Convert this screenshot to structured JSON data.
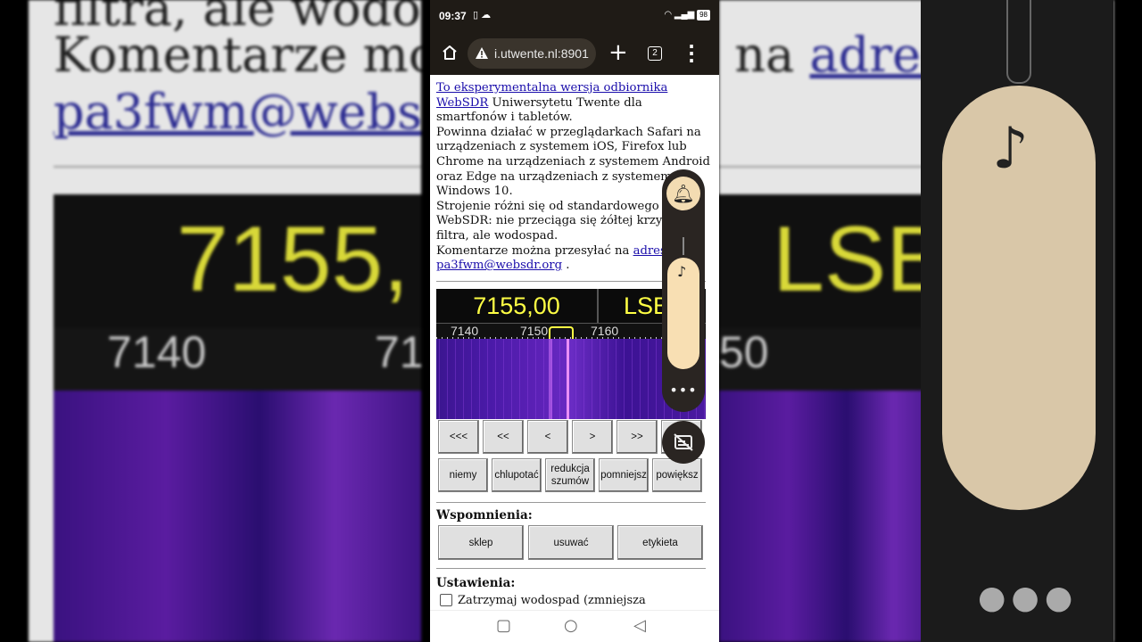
{
  "background": {
    "line1": "filtra, ale wodospad.",
    "line2_text": "Komentarze można przesyłać na ",
    "line2_link": "adres",
    "line3_link": "pa3fwm@websdr",
    "big_freq": "7155,",
    "big_mode": "LSB",
    "scale_left": [
      "7140",
      "71"
    ],
    "scale_right": "50"
  },
  "status_bar": {
    "time": "09:37",
    "battery": "98"
  },
  "browser": {
    "url": "i.utwente.nl:8901",
    "tab_count": "2"
  },
  "intro": {
    "link_text": "To eksperymentalna wersja odbiornika WebSDR",
    "after_link": " Uniwersytetu Twente dla smartfonów i tabletów.",
    "para2": "Powinna działać w przeglądarkach Safari na urządzeniach z systemem iOS, Firefox lub Chrome na urządzeniach z systemem Android oraz Edge na urządzeniach z systemem Windows 10.",
    "para3": "Strojenie różni się od standardowego WebSDR: nie przeciąga się żółtej krzywej filtra, ale wodospad.",
    "para4_text": "Komentarze można przesyłać na ",
    "para4_link": "adres",
    "email_link": "pa3fwm@websdr.org",
    "para4_end": " ."
  },
  "sdr": {
    "frequency": "7155,00",
    "mode": "LSB",
    "scale_labels": [
      "7140",
      "7150",
      "7160"
    ]
  },
  "tune_buttons": [
    "<<<",
    "<<",
    "<",
    ">",
    ">>",
    ">>>"
  ],
  "func_buttons": [
    "niemy",
    "chlupotać",
    "redukcja szumów",
    "pomniejsz",
    "powiększ"
  ],
  "memories": {
    "title": "Wspomnienia:",
    "buttons": [
      "sklep",
      "usuwać",
      "etykieta"
    ]
  },
  "settings": {
    "title": "Ustawienia:",
    "checkbox_label": "Zatrzymaj wodospad (zmniejsza"
  },
  "volume": {
    "level": 0.82,
    "more": "•••"
  }
}
